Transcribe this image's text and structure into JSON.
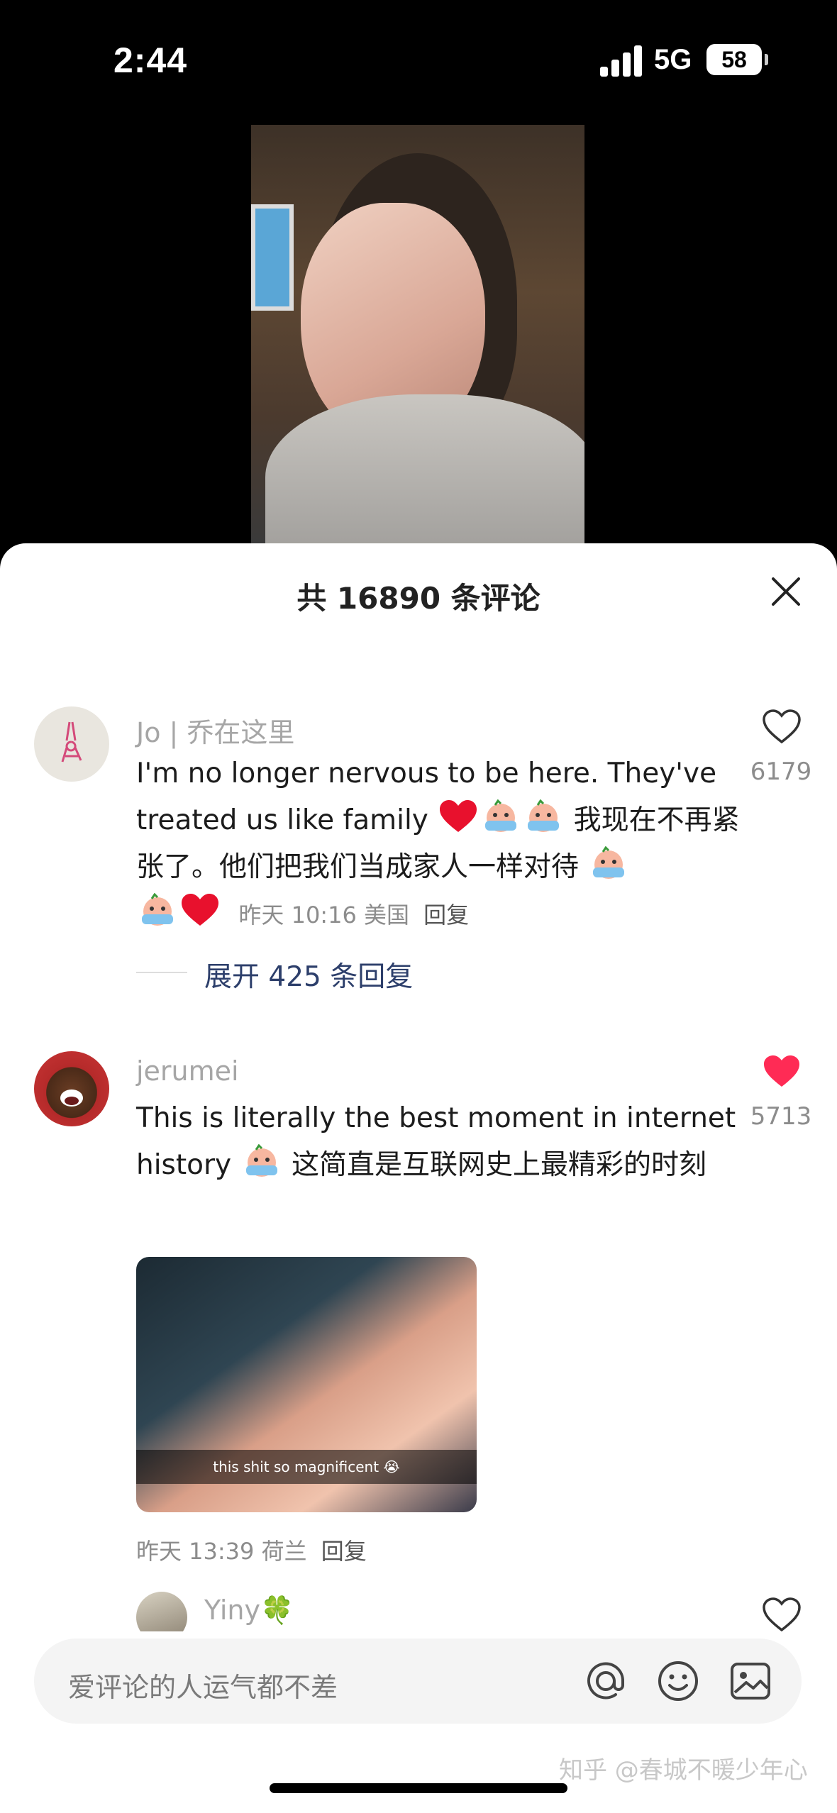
{
  "status": {
    "time": "2:44",
    "network": "5G",
    "battery": "58"
  },
  "sheet": {
    "title": "共 16890 条评论"
  },
  "comments": [
    {
      "user": "Jo | 乔在这里",
      "text_parts": [
        "I'm no longer nervous to be here. They've treated us like family ",
        " 我现在不再紧张了。他们把我们当成家人一样对待 "
      ],
      "time": "昨天 10:16",
      "location": "美国",
      "reply": "回复",
      "likes": "6179",
      "liked": false,
      "expand": "展开 425 条回复"
    },
    {
      "user": "jerumei",
      "text_parts": [
        "This is literally the best moment in internet history ",
        " 这简直是互联网史上最精彩的时刻"
      ],
      "image_caption": "this shit so magnificent 😭",
      "time": "昨天 13:39",
      "location": "荷兰",
      "reply": "回复",
      "likes": "5713",
      "liked": true
    },
    {
      "user": "Yiny🍀"
    }
  ],
  "input": {
    "placeholder": "爱评论的人运气都不差"
  },
  "watermark": "知乎 @春城不暖少年心",
  "colors": {
    "liked": "#ff2b55",
    "link": "#2d3f6b"
  }
}
